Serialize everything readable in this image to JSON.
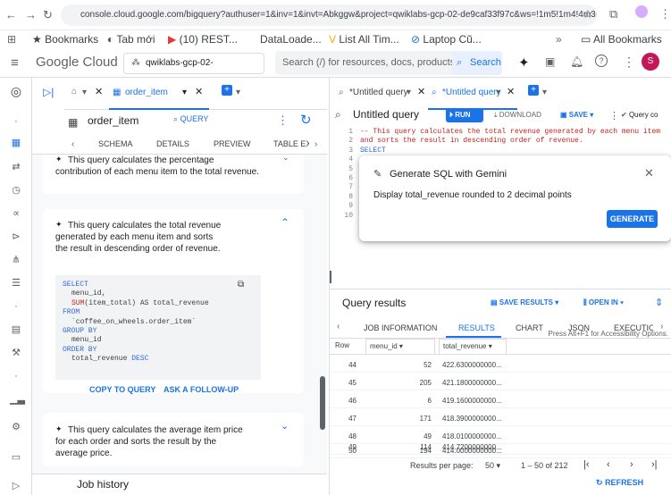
{
  "browser": {
    "url": "console.cloud.google.com/bigquery?authuser=1&inv=1&invt=Abkggw&project=qwiklabs-gcp-02-de9caf33f97c&ws=!1m5!1m4!4m3!1sqwikl...",
    "bookmarks": [
      "Bookmarks",
      "Tab mới",
      "(10) REST...",
      "DataLoade...",
      "List All Tim...",
      "Laptop Cũ...",
      "All Bookmarks"
    ],
    "avatar_letter": "S"
  },
  "gc_header": {
    "logo": "Google Cloud",
    "project": "qwiklabs-gcp-02-de9caf33f97c",
    "search_placeholder": "Search (/) for resources, docs, products, a...",
    "search_button": "Search",
    "avatar_letter": "S"
  },
  "left_panel": {
    "tab_label": "order_item",
    "table_title": "order_item",
    "query_button": "QUERY",
    "subtabs": [
      "SCHEMA",
      "DETAILS",
      "PREVIEW",
      "TABLE EX"
    ],
    "card1_text": "This query calculates the percentage contribution of each menu item to the total revenue.",
    "card2_text": "This query calculates the total revenue generated by each menu item and sorts the result in descending order of revenue.",
    "code": {
      "line1": "SELECT",
      "line2": "menu_id,",
      "line3_fn": "SUM",
      "line3_rest": "(item_total) AS total_revenue",
      "line4": "FROM",
      "line5": "`coffee_on_wheels.order_item`",
      "line6": "GROUP BY",
      "line7": "menu_id",
      "line8": "ORDER BY",
      "line9_a": "total_revenue",
      "line9_b": "DESC"
    },
    "copy_button": "COPY TO QUERY",
    "followup_button": "ASK A FOLLOW-UP",
    "card3_text": "This query calculates the average item price for each order and sorts the result by the average price.",
    "job_history": "Job history"
  },
  "right_panel": {
    "tabs": [
      "*Untitled query",
      "*Untitled query"
    ],
    "editor_title": "Untitled query",
    "run": "RUN",
    "download": "DOWNLOAD",
    "save": "SAVE",
    "query_status": "Query co",
    "line_numbers": [
      "1",
      "2",
      "3",
      "4",
      "5",
      "6",
      "7",
      "8",
      "9",
      "10"
    ],
    "code_line1": "-- This query calculates the total revenue generated by each menu item",
    "code_line2": "and sorts the result in descending order of revenue.",
    "code_line3": "SELECT",
    "access_hint": "Press Alt+F1 for Accessibility Options.",
    "results_title": "Query results",
    "save_results": "SAVE RESULTS",
    "open_in": "OPEN IN",
    "result_tabs": [
      "JOB INFORMATION",
      "RESULTS",
      "CHART",
      "JSON",
      "EXECUTION"
    ],
    "columns": [
      "Row",
      "menu_id",
      "total_revenue"
    ],
    "rows": [
      [
        "44",
        "52",
        "422.6300000000..."
      ],
      [
        "45",
        "205",
        "421.1800000000..."
      ],
      [
        "46",
        "6",
        "419.1600000000..."
      ],
      [
        "47",
        "171",
        "418.3900000000..."
      ],
      [
        "48",
        "49",
        "418.0100000000..."
      ],
      [
        "49",
        "114",
        "414.7200000000..."
      ],
      [
        "50",
        "194",
        "414.0000000000..."
      ]
    ],
    "results_per_page_label": "Results per page:",
    "results_per_page": "50",
    "range": "1 – 50 of 212",
    "refresh": "REFRESH"
  },
  "dialog": {
    "title": "Generate SQL with Gemini",
    "prompt": "Display total_revenue rounded to 2 decimal points",
    "generate": "GENERATE"
  },
  "colors": {
    "accent": "#1a73e8",
    "run_bg": "#1a73e8",
    "avatar_bg": "#c2185b"
  }
}
